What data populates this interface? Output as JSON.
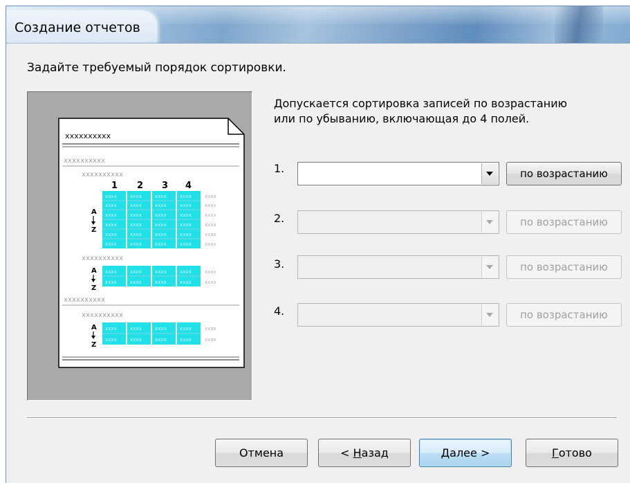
{
  "window": {
    "title": "Создание отчетов"
  },
  "prompt": "Задайте требуемый порядок сортировки.",
  "description": {
    "line1": "Допускается сортировка записей по возрастанию",
    "line2": "или по убыванию, включающая до 4 полей."
  },
  "sort_rows": [
    {
      "number": "1.",
      "field_value": "",
      "order_label": "по возрастанию",
      "enabled": true
    },
    {
      "number": "2.",
      "field_value": "",
      "order_label": "по возрастанию",
      "enabled": false
    },
    {
      "number": "3.",
      "field_value": "",
      "order_label": "по возрастанию",
      "enabled": false
    },
    {
      "number": "4.",
      "field_value": "",
      "order_label": "по возрастанию",
      "enabled": false
    }
  ],
  "preview": {
    "placeholder": "xxxxxxxxxx",
    "cell_placeholder": "xxxx",
    "column_numbers": [
      "1",
      "2",
      "3",
      "4"
    ],
    "sort_glyph_top": "A",
    "sort_glyph_bottom": "Z",
    "highlight_color": "#22e0e8"
  },
  "buttons": {
    "cancel": "Отмена",
    "back_prefix": "< ",
    "back_mnemonic": "Н",
    "back_rest": "азад",
    "next_mnemonic": "Д",
    "next_rest": "алее >",
    "finish_mnemonic": "Г",
    "finish_rest": "отово"
  }
}
